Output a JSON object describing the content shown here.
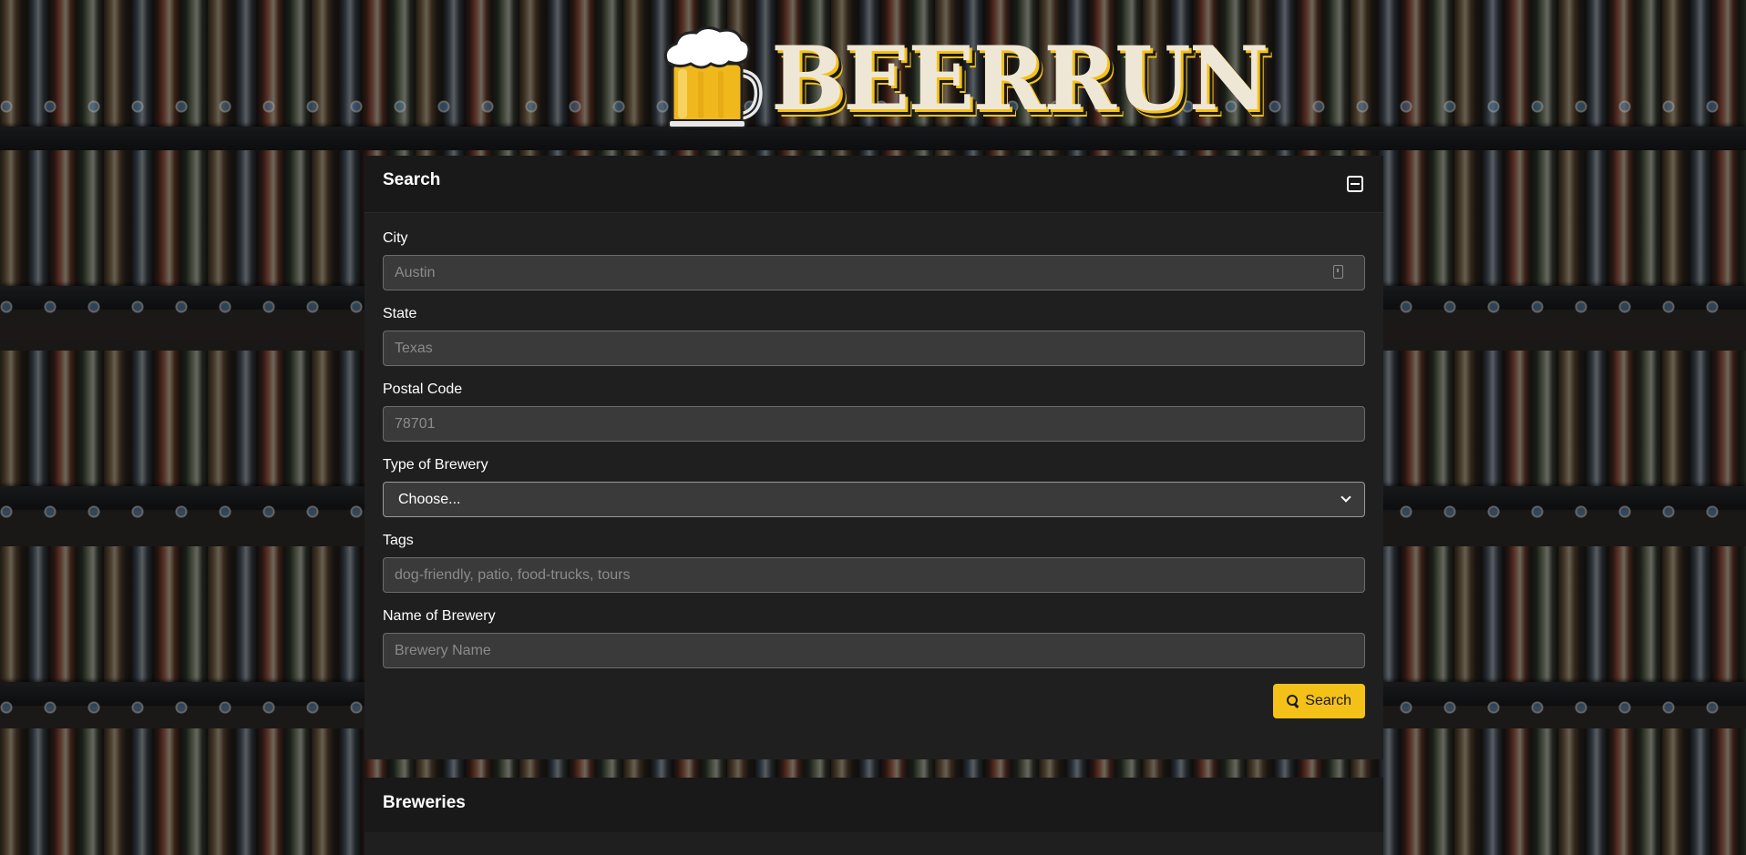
{
  "logo": {
    "text": "BEERRUN",
    "icon": "beer-mug-icon",
    "colors": {
      "accent": "#f4c118",
      "letter": "#efe7d6",
      "outline": "#1a1a1a"
    }
  },
  "search_panel": {
    "title": "Search",
    "collapse_icon": "minus-square-icon",
    "fields": {
      "city": {
        "label": "City",
        "placeholder": "Austin",
        "value": ""
      },
      "state": {
        "label": "State",
        "placeholder": "Texas",
        "value": ""
      },
      "postal_code": {
        "label": "Postal Code",
        "placeholder": "78701",
        "value": ""
      },
      "brewery_type": {
        "label": "Type of Brewery",
        "selected": "Choose..."
      },
      "tags": {
        "label": "Tags",
        "placeholder": "dog-friendly, patio, food-trucks, tours",
        "value": ""
      },
      "brewery_name": {
        "label": "Name of Brewery",
        "placeholder": "Brewery Name",
        "value": ""
      }
    },
    "submit": {
      "label": "Search",
      "icon": "search-icon"
    }
  },
  "results_panel": {
    "title": "Breweries"
  },
  "colors": {
    "card_bg": "#1f1f1f",
    "card_header_bg": "#191919",
    "input_bg": "#3a3a3a",
    "input_border": "#6c6c6c",
    "button_bg": "#f4c118"
  }
}
